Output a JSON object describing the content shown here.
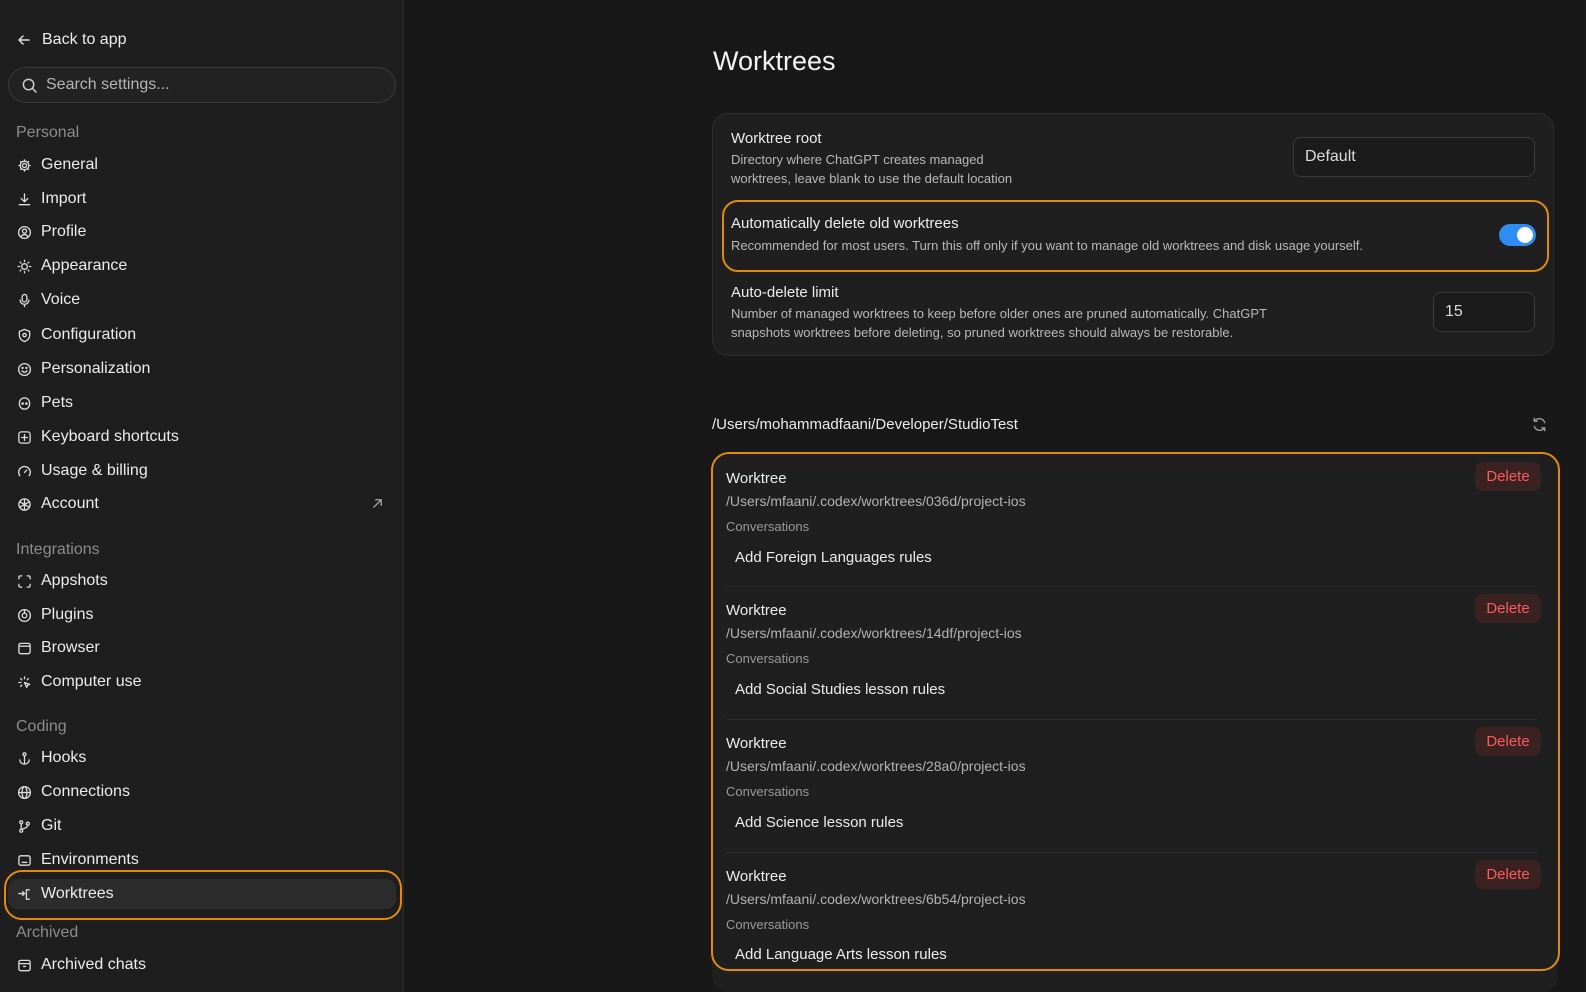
{
  "sidebar": {
    "back_label": "Back to app",
    "search_placeholder": "Search settings...",
    "sections": {
      "personal": "Personal",
      "integrations": "Integrations",
      "coding": "Coding",
      "archived": "Archived"
    },
    "items": {
      "general": "General",
      "import": "Import",
      "profile": "Profile",
      "appearance": "Appearance",
      "voice": "Voice",
      "configuration": "Configuration",
      "personalization": "Personalization",
      "pets": "Pets",
      "keyboard_shortcuts": "Keyboard shortcuts",
      "usage_billing": "Usage & billing",
      "account": "Account",
      "appshots": "Appshots",
      "plugins": "Plugins",
      "browser": "Browser",
      "computer_use": "Computer use",
      "hooks": "Hooks",
      "connections": "Connections",
      "git": "Git",
      "environments": "Environments",
      "worktrees": "Worktrees",
      "archived_chats": "Archived chats"
    },
    "active_item": "Worktrees"
  },
  "main": {
    "title": "Worktrees",
    "settings": {
      "root": {
        "title": "Worktree root",
        "desc_line1": "Directory where ChatGPT creates managed",
        "desc_line2": "worktrees, leave blank to use the default location",
        "value": "Default"
      },
      "auto_delete": {
        "title": "Automatically delete old worktrees",
        "desc": "Recommended for most users. Turn this off only if you want to manage old worktrees and disk usage yourself.",
        "enabled": true
      },
      "limit": {
        "title": "Auto-delete limit",
        "desc_line1": "Number of managed worktrees to keep before older ones are pruned automatically. ChatGPT",
        "desc_line2": "snapshots worktrees before deleting, so pruned worktrees should always be restorable.",
        "value": "15"
      }
    },
    "repo_path": "/Users/mohammadfaani/Developer/StudioTest",
    "worktrees": [
      {
        "label": "Worktree",
        "path": "/Users/mfaani/.codex/worktrees/036d/project-ios",
        "conversations_label": "Conversations",
        "conversation": "Add Foreign Languages rules",
        "delete_label": "Delete"
      },
      {
        "label": "Worktree",
        "path": "/Users/mfaani/.codex/worktrees/14df/project-ios",
        "conversations_label": "Conversations",
        "conversation": "Add Social Studies lesson rules",
        "delete_label": "Delete"
      },
      {
        "label": "Worktree",
        "path": "/Users/mfaani/.codex/worktrees/28a0/project-ios",
        "conversations_label": "Conversations",
        "conversation": "Add Science lesson rules",
        "delete_label": "Delete"
      },
      {
        "label": "Worktree",
        "path": "/Users/mfaani/.codex/worktrees/6b54/project-ios",
        "conversations_label": "Conversations",
        "conversation": "Add Language Arts lesson rules",
        "delete_label": "Delete"
      }
    ]
  },
  "colors": {
    "accent": "#2f8cf5",
    "highlight": "#e08a12",
    "danger": "#ff5b5b"
  }
}
